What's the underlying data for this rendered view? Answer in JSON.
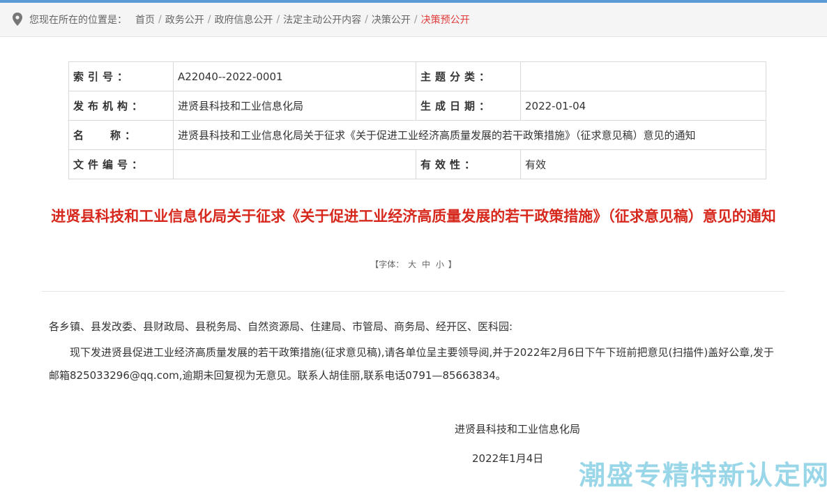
{
  "breadcrumb": {
    "label": "您现在所在的位置是：",
    "items": [
      "首页",
      "政务公开",
      "政府信息公开",
      "法定主动公开内容",
      "决策公开"
    ],
    "current": "决策预公开"
  },
  "meta": {
    "index_key": "索引号：",
    "index_val": "A22040--2022-0001",
    "topic_key": "主题分类：",
    "topic_val": "",
    "org_key": "发布机构：",
    "org_val": "进贤县科技和工业信息化局",
    "date_key": "生成日期：",
    "date_val": "2022-01-04",
    "name_key_a": "名",
    "name_key_b": "称：",
    "name_val": "进贤县科技和工业信息化局关于征求《关于促进工业经济高质量发展的若干政策措施》（征求意见稿）意见的通知",
    "doc_key": "文件编号：",
    "doc_val": "",
    "valid_key": "有效性：",
    "valid_val": "有效"
  },
  "article": {
    "title": "进贤县科技和工业信息化局关于征求《关于促进工业经济高质量发展的若干政策措施》（征求意见稿）意见的通知",
    "fontsize_label": "【字体：",
    "fontsize_big": "大",
    "fontsize_mid": "中",
    "fontsize_small": "小",
    "fontsize_end": "】",
    "addressees": "各乡镇、县发改委、县财政局、县税务局、自然资源局、住建局、市管局、商务局、经开区、医科园:",
    "paragraph": "现下发进贤县促进工业经济高质量发展的若干政策措施(征求意见稿),请各单位呈主要领导阅,并于2022年2月6日下午下班前把意见(扫描件)盖好公章,发于邮箱825033296@qq.com,逾期未回复视为无意见。联系人胡佳丽,联系电话0791—85663834。",
    "signer": "进贤县科技和工业信息化局",
    "sign_date": "2022年1月4日"
  },
  "watermark": "潮盛专精特新认定网",
  "colors": {
    "accent_red": "#d7281d",
    "breadcrumb_current": "#e03a3a",
    "topbar": "#5b9bd5",
    "watermark": "#8fd3e6"
  }
}
